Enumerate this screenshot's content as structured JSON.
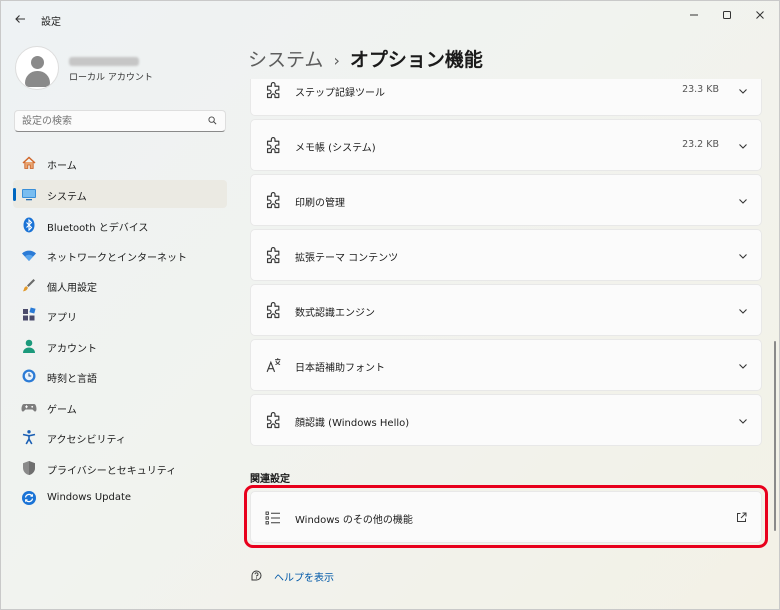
{
  "window": {
    "title": "設定",
    "back_icon": "back-arrow-icon",
    "controls": [
      "minimize-icon",
      "maximize-icon",
      "close-icon"
    ]
  },
  "profile": {
    "account_type": "ローカル アカウント"
  },
  "search": {
    "placeholder": "設定の検索"
  },
  "nav": {
    "items": [
      {
        "label": "ホーム",
        "icon": "home-icon",
        "active": false
      },
      {
        "label": "システム",
        "icon": "system-monitor-icon",
        "active": true
      },
      {
        "label": "Bluetooth とデバイス",
        "icon": "bluetooth-icon",
        "active": false
      },
      {
        "label": "ネットワークとインターネット",
        "icon": "wifi-icon",
        "active": false
      },
      {
        "label": "個人用設定",
        "icon": "paint-brush-icon",
        "active": false
      },
      {
        "label": "アプリ",
        "icon": "apps-icon",
        "active": false
      },
      {
        "label": "アカウント",
        "icon": "account-icon",
        "active": false
      },
      {
        "label": "時刻と言語",
        "icon": "time-language-icon",
        "active": false
      },
      {
        "label": "ゲーム",
        "icon": "gamepad-icon",
        "active": false
      },
      {
        "label": "アクセシビリティ",
        "icon": "accessibility-icon",
        "active": false
      },
      {
        "label": "プライバシーとセキュリティ",
        "icon": "shield-icon",
        "active": false
      },
      {
        "label": "Windows Update",
        "icon": "windows-update-icon",
        "active": false
      }
    ]
  },
  "header": {
    "parent": "システム",
    "separator": "›",
    "current": "オプション機能"
  },
  "features": [
    {
      "name": "ステップ記録ツール",
      "size": "23.3 KB",
      "icon": "puzzle-icon"
    },
    {
      "name": "メモ帳 (システム)",
      "size": "23.2 KB",
      "icon": "puzzle-icon"
    },
    {
      "name": "印刷の管理",
      "size": "",
      "icon": "puzzle-icon"
    },
    {
      "name": "拡張テーマ コンテンツ",
      "size": "",
      "icon": "puzzle-icon"
    },
    {
      "name": "数式認識エンジン",
      "size": "",
      "icon": "puzzle-icon"
    },
    {
      "name": "日本語補助フォント",
      "size": "",
      "icon": "font-icon"
    },
    {
      "name": "顔認識 (Windows Hello)",
      "size": "",
      "icon": "puzzle-icon"
    }
  ],
  "related": {
    "section_title": "関連設定",
    "item_label": "Windows のその他の機能",
    "item_icon": "list-icon",
    "external_icon": "external-link-icon"
  },
  "help": {
    "label": "ヘルプを表示",
    "icon": "help-icon"
  },
  "colors": {
    "accent": "#0067c0",
    "highlight": "#e8001c",
    "link": "#0058a8"
  }
}
